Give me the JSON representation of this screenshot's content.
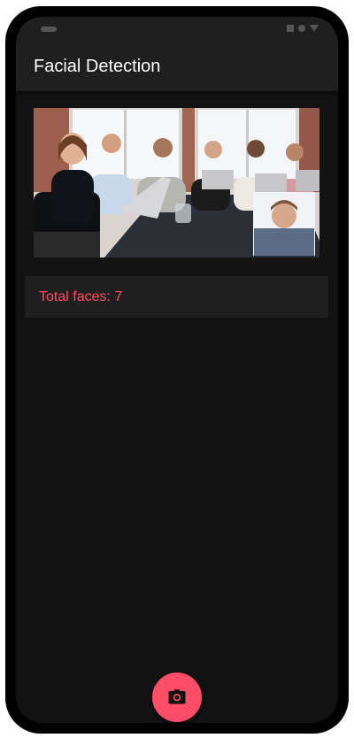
{
  "app": {
    "title": "Facial Detection"
  },
  "result": {
    "text": "Total faces: 7"
  },
  "fab": {
    "icon": "camera-icon"
  },
  "colors": {
    "accent": "#ff4d67",
    "background": "#121212",
    "surface": "#1f1f1f"
  }
}
